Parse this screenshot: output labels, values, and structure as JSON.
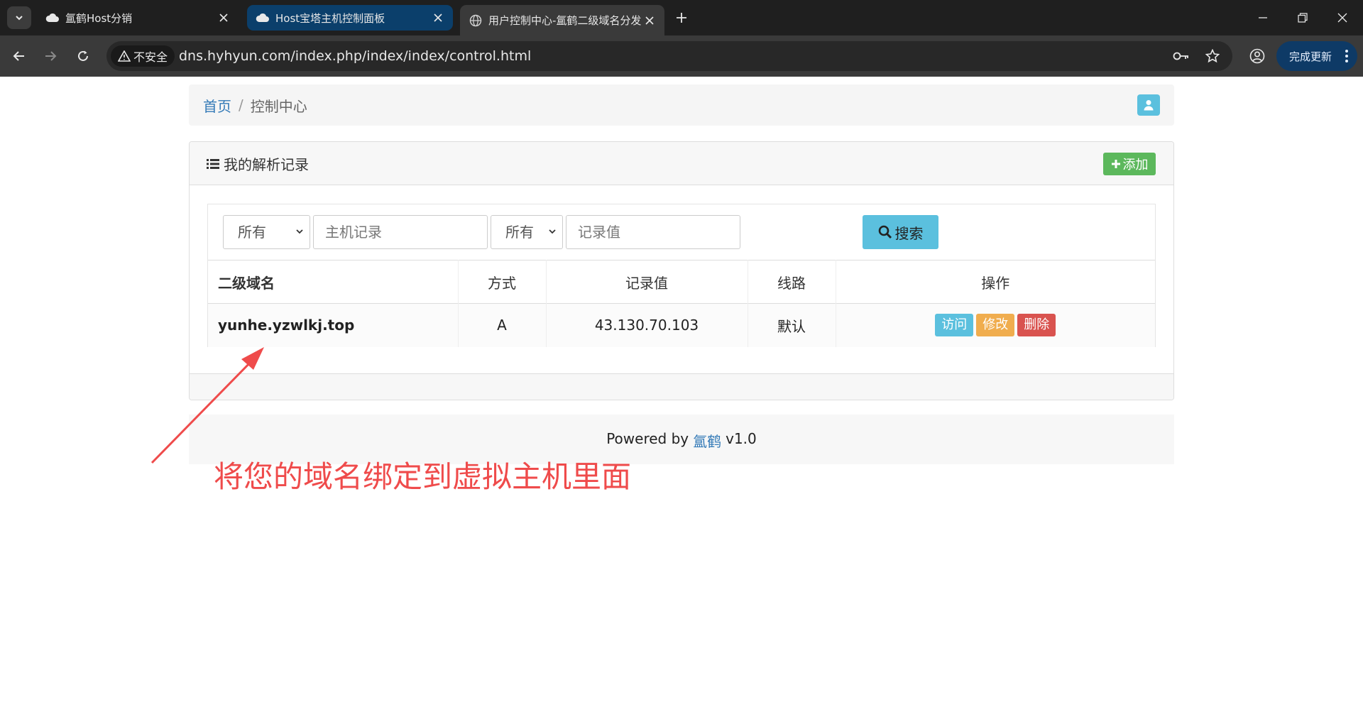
{
  "browser": {
    "tabs": [
      {
        "title": "氲鹤Host分销",
        "icon": "cloud-icon"
      },
      {
        "title": "Host宝塔主机控制面板",
        "icon": "cloud-icon"
      },
      {
        "title": "用户控制中心-氲鹤二级域名分发",
        "icon": "globe-icon"
      }
    ],
    "insecure_label": "不安全",
    "url": "dns.hyhyun.com/index.php/index/index/control.html",
    "update_label": "完成更新",
    "colors": {
      "active_tab": "#0b3f6b",
      "toolbar": "#3a3a3a",
      "tabbar": "#1f1f1f"
    }
  },
  "breadcrumb": {
    "home": "首页",
    "separator": "/",
    "current": "控制中心"
  },
  "panel": {
    "title": "我的解析记录",
    "add_label": "添加",
    "filters": {
      "type_select": "所有",
      "host_placeholder": "主机记录",
      "line_select": "所有",
      "value_placeholder": "记录值",
      "search_label": "搜索"
    },
    "table": {
      "headers": [
        "二级域名",
        "方式",
        "记录值",
        "线路",
        "操作"
      ],
      "rows": [
        {
          "domain": "yunhe.yzwlkj.top",
          "type": "A",
          "value": "43.130.70.103",
          "line": "默认",
          "actions": [
            "访问",
            "修改",
            "删除"
          ]
        }
      ]
    }
  },
  "footer": {
    "prefix": "Powered by",
    "brand": "氲鹤",
    "version": "v1.0"
  },
  "annotation": {
    "text": "将您的域名绑定到虚拟主机里面",
    "color": "#ef4b4b"
  }
}
